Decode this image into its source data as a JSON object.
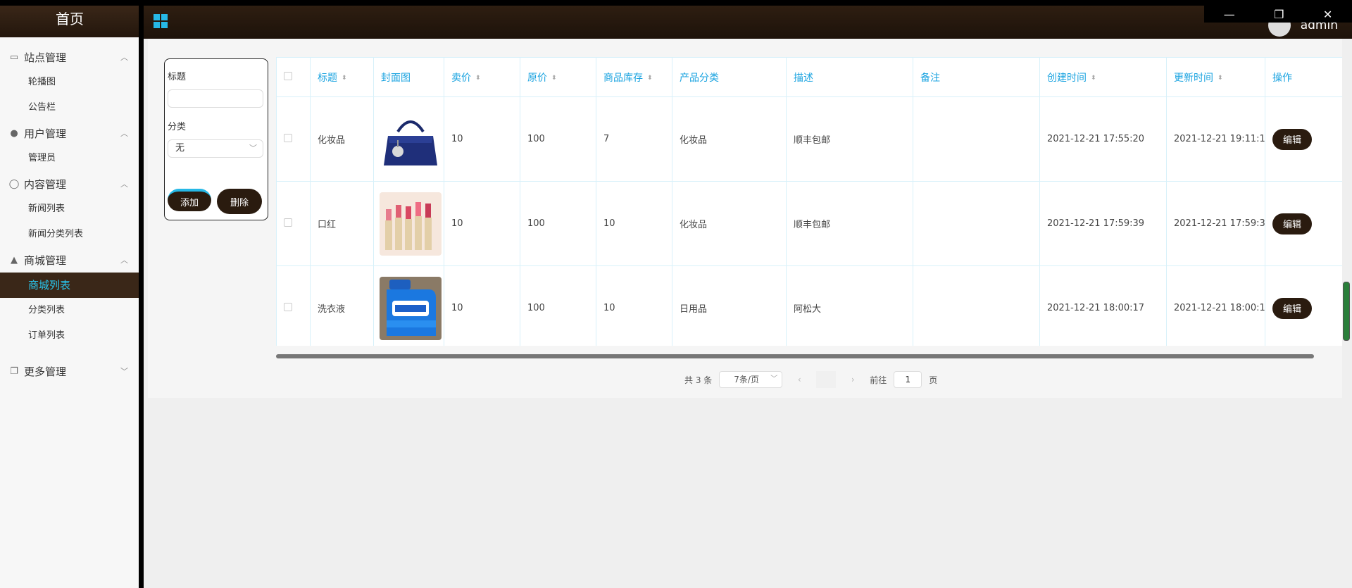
{
  "sidebar": {
    "home": "首页",
    "groups": [
      {
        "label": "站点管理",
        "icon": "monitor-icon",
        "items": [
          "轮播图",
          "公告栏"
        ]
      },
      {
        "label": "用户管理",
        "icon": "user-icon",
        "items": [
          "管理员"
        ]
      },
      {
        "label": "内容管理",
        "icon": "chat-icon",
        "items": [
          "新闻列表",
          "新闻分类列表"
        ]
      },
      {
        "label": "商城管理",
        "icon": "shop-icon",
        "items": [
          "商城列表",
          "分类列表",
          "订单列表"
        ]
      },
      {
        "label": "更多管理",
        "icon": "copy-icon",
        "items": []
      }
    ],
    "active_item": "商城列表"
  },
  "topbar": {
    "username": "admin",
    "window_controls": [
      "—",
      "❐",
      "✕"
    ]
  },
  "form": {
    "title_label": "标题",
    "title_value": "",
    "category_label": "分类",
    "category_value": "无",
    "add_label": "添加",
    "delete_label": "删除"
  },
  "table": {
    "headers": [
      "标题",
      "封面图",
      "卖价",
      "原价",
      "商品库存",
      "产品分类",
      "描述",
      "备注",
      "创建时间",
      "更新时间",
      "操作"
    ],
    "rows": [
      {
        "title": "化妆品",
        "cover": "handbag-image",
        "price": "10",
        "original": "100",
        "stock": "7",
        "category": "化妆品",
        "desc": "顺丰包邮",
        "note": "",
        "created": "2021-12-21 17:55:20",
        "updated": "2021-12-21 19:11:1",
        "action": "编辑"
      },
      {
        "title": "口红",
        "cover": "lipstick-image",
        "price": "10",
        "original": "100",
        "stock": "10",
        "category": "化妆品",
        "desc": "顺丰包邮",
        "note": "",
        "created": "2021-12-21 17:59:39",
        "updated": "2021-12-21 17:59:3",
        "action": "编辑"
      },
      {
        "title": "洗衣液",
        "cover": "detergent-image",
        "price": "10",
        "original": "100",
        "stock": "10",
        "category": "日用品",
        "desc": "阿松大",
        "note": "",
        "created": "2021-12-21 18:00:17",
        "updated": "2021-12-21 18:00:1",
        "action": "编辑"
      }
    ]
  },
  "pagination": {
    "total": "共 3 条",
    "page_size": "7条/页",
    "goto_label": "前往",
    "goto_value": "1",
    "page_suffix": "页"
  }
}
